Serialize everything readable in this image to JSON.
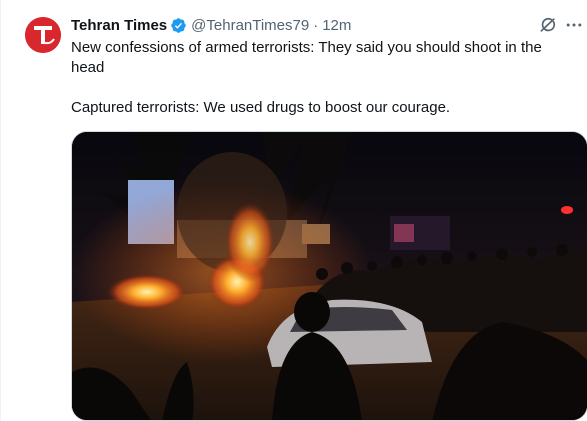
{
  "tweet": {
    "author": {
      "display_name": "Tehran Times",
      "handle": "@TehranTimes79",
      "verified": true,
      "avatar_letter": "T",
      "avatar_color": "#d9272e"
    },
    "separator": "·",
    "timestamp": "12m",
    "text": "New confessions of armed terrorists: They said you should shoot in the head\n\nCaptured terrorists: We used drugs to boost our courage.",
    "media": {
      "type": "photo"
    },
    "icons": {
      "verified": "verified-badge-icon",
      "grok": "grok-icon",
      "more": "more-options-icon"
    }
  },
  "colors": {
    "verified_blue": "#1d9bf0",
    "secondary_text": "#536471",
    "text": "#0f1419"
  }
}
